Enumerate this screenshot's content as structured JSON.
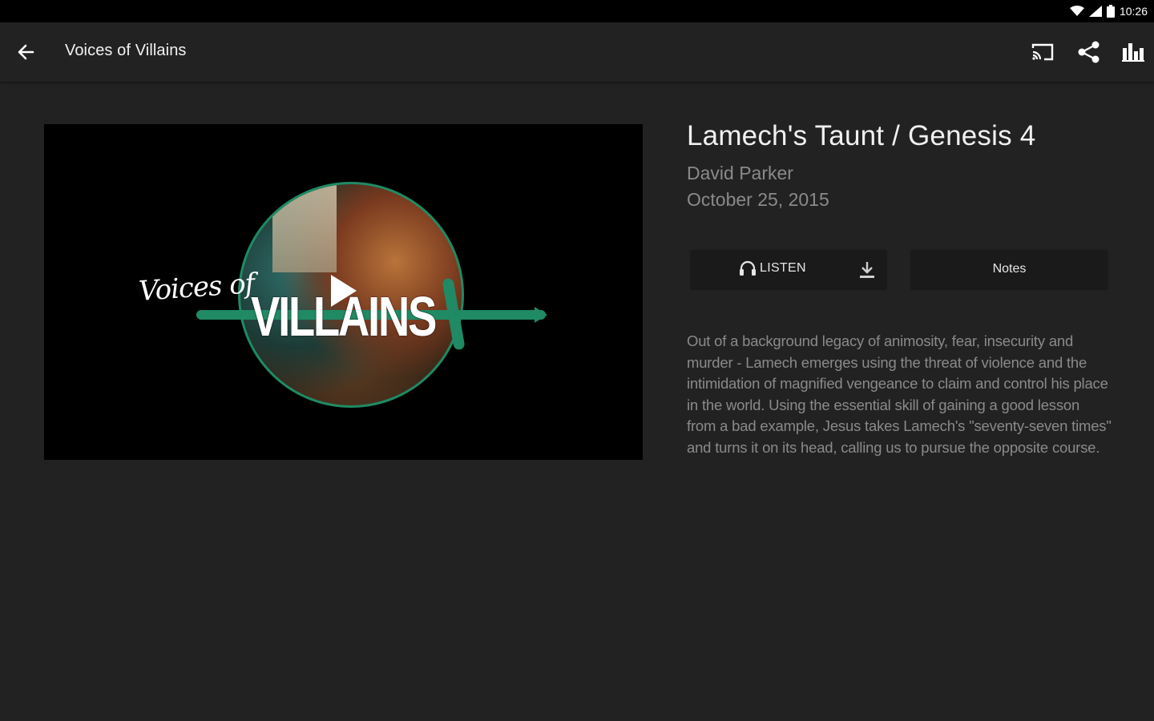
{
  "status_bar": {
    "time": "10:26"
  },
  "app_bar": {
    "title": "Voices of Villains",
    "actions": [
      "cast-icon",
      "share-icon",
      "bar-chart-icon"
    ]
  },
  "artwork": {
    "script_text": "Voices of",
    "main_text": "VILLAINS",
    "accent_color": "#1f8a63"
  },
  "episode": {
    "title": "Lamech's Taunt / Genesis 4",
    "author": "David Parker",
    "date": "October 25, 2015",
    "listen_label": "LISTEN",
    "notes_label": "Notes",
    "description": "Out of a background legacy of animosity, fear, insecurity and murder - Lamech emerges using the threat of violence and the intimidation of magnified vengeance to claim and control his place in the world.  Using the essential skill of gaining a good lesson from a bad example, Jesus takes Lamech's \"seventy-seven times\" and turns it on its head, calling us to pursue the opposite course."
  },
  "colors": {
    "background": "#222222",
    "status_bar": "#000000",
    "button_bg": "#1a1a1a",
    "secondary_text": "#8a8a8a"
  }
}
